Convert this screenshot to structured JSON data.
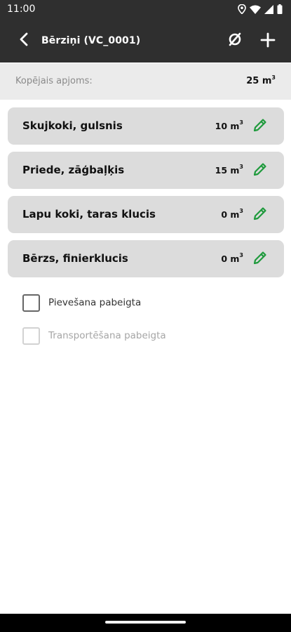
{
  "status_bar": {
    "time": "11:00",
    "icons": [
      "location-icon",
      "wifi-icon",
      "cellular-signal-icon",
      "battery-icon"
    ]
  },
  "app_bar": {
    "title": "Bērziņi (VC_0001)",
    "icons": [
      "back-arrow-icon",
      "clear-empty-set-icon",
      "add-plus-icon"
    ]
  },
  "summary": {
    "label": "Kopējais apjoms:",
    "value": "25 m",
    "unit_superscript": "3"
  },
  "items": [
    {
      "name": "Skujkoki, gulsnis",
      "volume": "10 m",
      "unit_superscript": "3"
    },
    {
      "name": "Priede, zāģbaļķis",
      "volume": "15 m",
      "unit_superscript": "3"
    },
    {
      "name": "Lapu koki, taras klucis",
      "volume": "0 m",
      "unit_superscript": "3"
    },
    {
      "name": "Bērzs, finierklucis",
      "volume": "0 m",
      "unit_superscript": "3"
    }
  ],
  "checkboxes": [
    {
      "label": "Pievešana pabeigta",
      "checked": false,
      "enabled": true
    },
    {
      "label": "Transportēšana pabeigta",
      "checked": false,
      "enabled": false
    }
  ],
  "colors": {
    "app_bar_bg": "#2f2f2f",
    "summary_bg": "#ebebeb",
    "item_bg": "#dcdcdc",
    "edit_icon": "#1e9a3c",
    "muted_text": "#8a8a8a",
    "disabled_text": "#a5a5a5"
  }
}
